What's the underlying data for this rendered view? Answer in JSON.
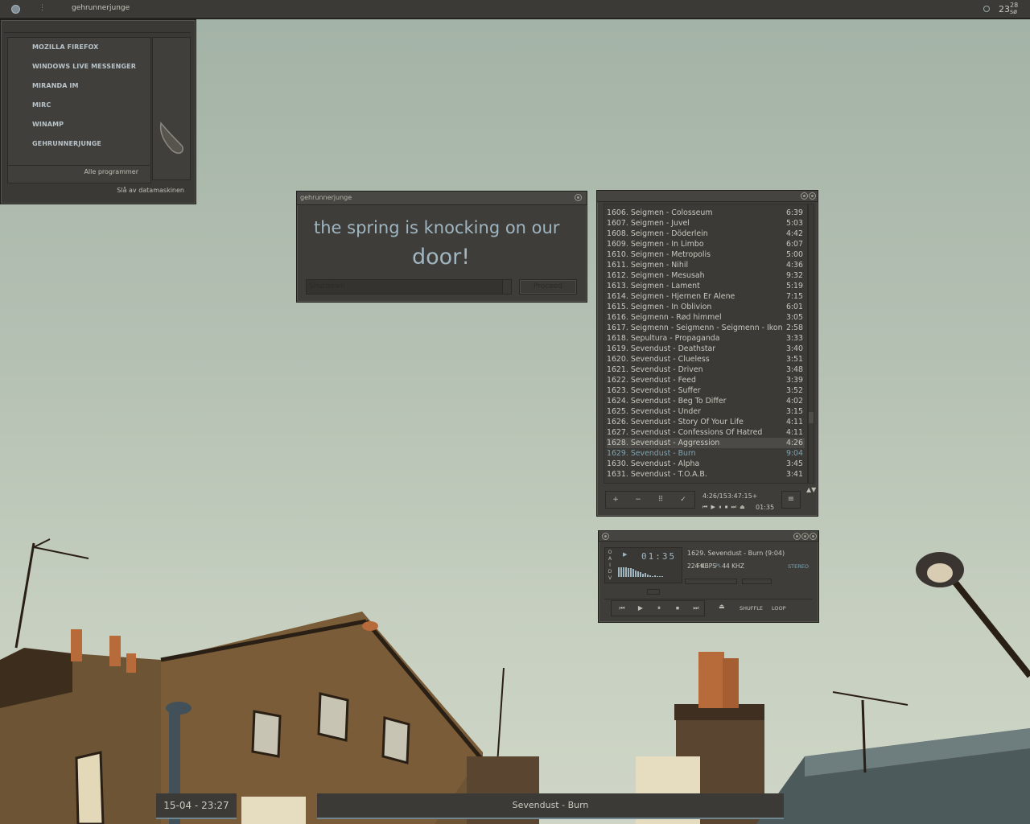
{
  "topbar": {
    "username": "gehrunnerjunge",
    "clock_hour": "23",
    "clock_min": "28",
    "clock_day": "sø"
  },
  "startmenu": {
    "items": [
      "MOZILLA FIREFOX",
      "WINDOWS LIVE MESSENGER",
      "MIRANDA IM",
      "MIRC",
      "WINAMP",
      "GEHRUNNERJUNGE"
    ],
    "all_programs": "Alle programmer",
    "shutdown": "Slå av datamaskinen"
  },
  "dialog": {
    "title": "gehrunnerjunge",
    "message_line1": "the spring is knocking on our",
    "message_line2": "door!",
    "select_value": "Shutdown",
    "proceed": "Proceed"
  },
  "playlist": {
    "rows": [
      {
        "title": "1606. Seigmen - Colosseum",
        "dur": "6:39"
      },
      {
        "title": "1607. Seigmen - Juvel",
        "dur": "5:03"
      },
      {
        "title": "1608. Seigmen - Döderlein",
        "dur": "4:42"
      },
      {
        "title": "1609. Seigmen - In Limbo",
        "dur": "6:07"
      },
      {
        "title": "1610. Seigmen - Metropolis",
        "dur": "5:00"
      },
      {
        "title": "1611. Seigmen - Nihil",
        "dur": "4:36"
      },
      {
        "title": "1612. Seigmen - Mesusah",
        "dur": "9:32"
      },
      {
        "title": "1613. Seigmen - Lament",
        "dur": "5:19"
      },
      {
        "title": "1614. Seigmen - Hjernen Er Alene",
        "dur": "7:15"
      },
      {
        "title": "1615. Seigmen - In Oblivion",
        "dur": "6:01"
      },
      {
        "title": "1616. Seigmenn - Rød himmel",
        "dur": "3:05"
      },
      {
        "title": "1617. Seigmenn - Seigmenn - Seigmenn - Ikon",
        "dur": "2:58"
      },
      {
        "title": "1618. Sepultura - Propaganda",
        "dur": "3:33"
      },
      {
        "title": "1619. Sevendust - Deathstar",
        "dur": "3:40"
      },
      {
        "title": "1620. Sevendust - Clueless",
        "dur": "3:51"
      },
      {
        "title": "1621. Sevendust - Driven",
        "dur": "3:48"
      },
      {
        "title": "1622. Sevendust - Feed",
        "dur": "3:39"
      },
      {
        "title": "1623. Sevendust - Suffer",
        "dur": "3:52"
      },
      {
        "title": "1624. Sevendust - Beg To Differ",
        "dur": "4:02"
      },
      {
        "title": "1625. Sevendust - Under",
        "dur": "3:15"
      },
      {
        "title": "1626. Sevendust - Story Of Your Life",
        "dur": "4:11"
      },
      {
        "title": "1627. Sevendust - Confessions Of Hatred",
        "dur": "4:11"
      },
      {
        "title": "1628. Sevendust - Aggression",
        "dur": "4:26"
      },
      {
        "title": "1629. Sevendust - Burn",
        "dur": "9:04"
      },
      {
        "title": "1630. Sevendust - Alpha",
        "dur": "3:45"
      },
      {
        "title": "1631. Sevendust - T.O.A.B.",
        "dur": "3:41"
      }
    ],
    "selected_index": 22,
    "current_index": 23,
    "btn_add": "+",
    "btn_rem": "−",
    "btn_sel": "⠿",
    "btn_misc": "✓",
    "total_time": "4:26/153:47:15+",
    "mini_controls": "⏮ ▶ ⏸ ⏹ ⏭ ⏏",
    "mini_time": "01:35",
    "menu_btn": "≡",
    "updown": "▲▼"
  },
  "player": {
    "oaidv": [
      "O",
      "A",
      "I",
      "D",
      "V"
    ],
    "play_indicator": "▶",
    "time": "01:35",
    "song": "1629. Sevendust - Burn (9:04)",
    "kbps": "224 KBPS",
    "khz": "44 KHZ",
    "stereo": "STEREO",
    "eq": "EQ",
    "pl": "PL",
    "prev": "⏮",
    "play": "▶",
    "pause": "⏸",
    "stop": "⏹",
    "next": "⏭",
    "eject": "⏏",
    "shuffle": "SHUFFLE",
    "loop": "LOOP"
  },
  "widgets": {
    "date": "15-04 - 23:27",
    "now_playing": "Sevendust - Burn"
  },
  "colors": {
    "panel": "#3e3d3a",
    "accent": "#7fa3b1",
    "text": "#c8c8be"
  }
}
